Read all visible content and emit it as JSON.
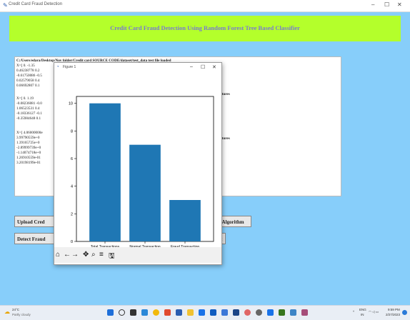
{
  "window": {
    "title": "Credit Card Fraud Detection",
    "minimize": "–",
    "maximize": "☐",
    "close": "✕"
  },
  "banner": {
    "text": "Credit Card Fraud Detection Using Random Forest Tree Based Classifier"
  },
  "output_lines": [
    "C:/Users/edara/Desktop/Nov folder/Credit card SOURCE CODE/dataset/test_data test file loaded",
    "X=[ 0.       -1.35",
    "  0.46238778  0.2",
    " -0.61750086 -0.5",
    "  0.02579058  0.4",
    "  0.06692807  0.1",
    "X=[ 0.        1.19",
    " -0.08236081 -0.0",
    "  1.06523531  0.4",
    " -0.18336127 -0.1",
    " -0.35984648  0.1",
    "X=[ 4.06000000e",
    "  3.99790559e+0",
    "  1.39165725e+0",
    " -2.89999739e+0",
    " -1.14074718e+0",
    "  1.26910559e-01",
    "  3.20198199e-01"
  ],
  "output_fragments": [
    "atures",
    "atures"
  ],
  "buttons": {
    "upload": "Upload Cred",
    "detect": "Detect Fraud",
    "algo": "est Algorithm",
    "small": "t"
  },
  "figure": {
    "title": "Figure 1",
    "minimize": "–",
    "maximize": "☐",
    "close": "✕",
    "toolbar": [
      "⌂",
      "←",
      "→",
      "✥",
      "⌕",
      "≡",
      "🖫"
    ]
  },
  "chart_data": {
    "type": "bar",
    "categories": [
      "Total Transactions",
      "Normal Transaction",
      "Fraud Transaction"
    ],
    "values": [
      10,
      7,
      3
    ],
    "ylim": [
      0,
      10.5
    ],
    "yticks": [
      0,
      2,
      4,
      6,
      8,
      10
    ],
    "bar_color": "#1f77b4"
  },
  "taskbar": {
    "weather_temp": "24°C",
    "weather_desc": "Partly cloudy",
    "lang": "ENG",
    "lang2": "IN",
    "time": "9:59 PM",
    "date": "2/27/2023"
  }
}
